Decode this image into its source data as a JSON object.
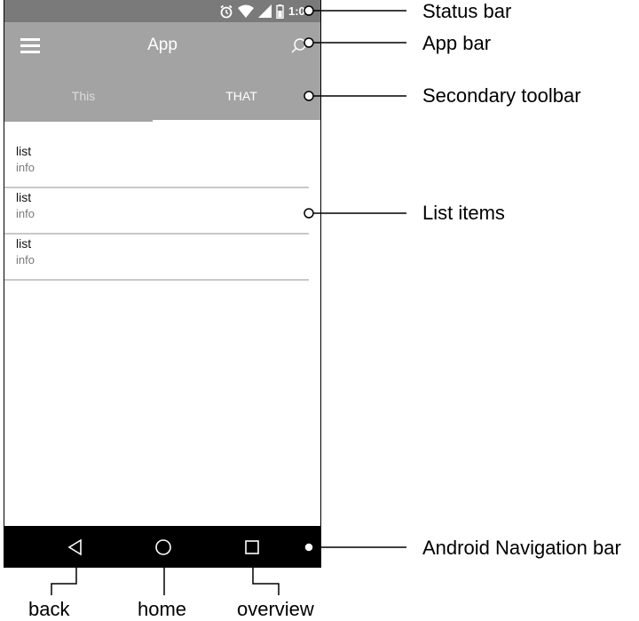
{
  "status_bar": {
    "time": "1:00"
  },
  "app_bar": {
    "title": "App"
  },
  "secondary_toolbar": {
    "tabs": [
      {
        "label": "This"
      },
      {
        "label": "THAT"
      }
    ]
  },
  "list": {
    "items": [
      {
        "title": "list",
        "info": "info"
      },
      {
        "title": "list",
        "info": "info"
      },
      {
        "title": "list",
        "info": "info"
      }
    ]
  },
  "callouts": {
    "status_bar": "Status bar",
    "app_bar": "App bar",
    "secondary_toolbar": "Secondary toolbar",
    "list_items": "List items",
    "nav_bar": "Android Navigation bar"
  },
  "nav_labels": {
    "back": "back",
    "home": "home",
    "overview": "overview"
  },
  "icons": {
    "menu": "hamburger-menu-icon",
    "search": "search-icon",
    "alarm": "alarm-icon",
    "wifi": "wifi-icon",
    "signal": "cellular-signal-icon",
    "battery": "battery-icon",
    "back": "back-triangle-icon",
    "home": "home-circle-icon",
    "overview": "overview-square-icon"
  },
  "colors": {
    "status_bar": "#7a7a7a",
    "app_bar": "#a3a3a3",
    "nav_bar": "#000000",
    "divider": "#c8c8c8"
  }
}
